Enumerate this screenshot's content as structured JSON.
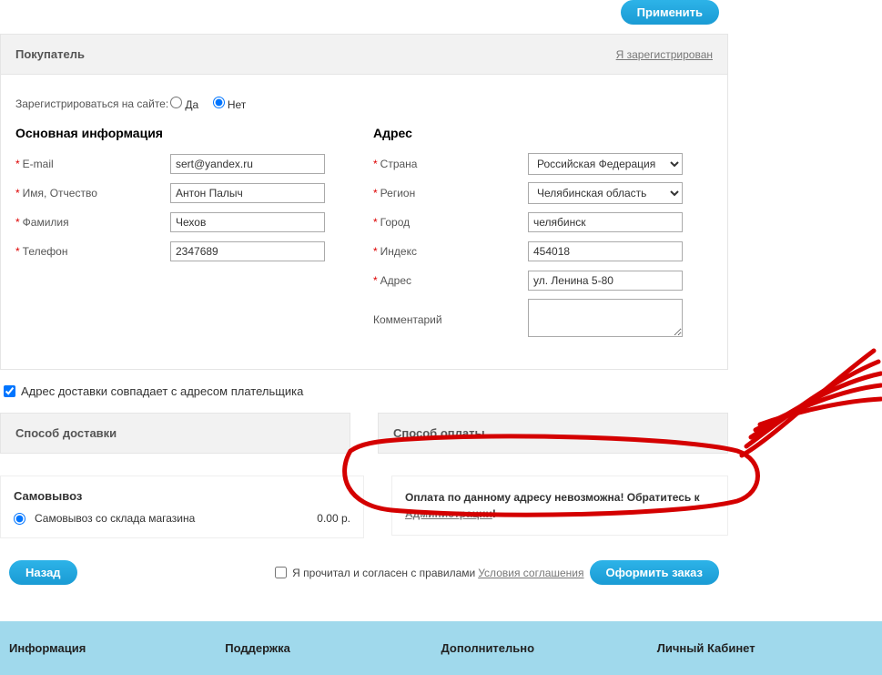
{
  "top": {
    "apply_label": "Применить"
  },
  "buyer_section": {
    "title": "Покупатель",
    "registered_link": "Я зарегистрирован"
  },
  "register": {
    "label": "Зарегистрироваться на сайте:",
    "yes": "Да",
    "no": "Нет"
  },
  "main_info_title": "Основная информация",
  "main_info": {
    "email_label": "E-mail",
    "email_value": "sert@yandex.ru",
    "name_label": "Имя, Отчество",
    "name_value": "Антон Палыч",
    "surname_label": "Фамилия",
    "surname_value": "Чехов",
    "phone_label": "Телефон",
    "phone_value": "2347689"
  },
  "address_title": "Адрес",
  "address": {
    "country_label": "Страна",
    "country_value": "Российская Федерация",
    "region_label": "Регион",
    "region_value": "Челябинская область",
    "city_label": "Город",
    "city_value": "челябинск",
    "index_label": "Индекс",
    "index_value": "454018",
    "addr_label": "Адрес",
    "addr_value": "ул. Ленина 5-80",
    "comment_label": "Комментарий",
    "comment_value": ""
  },
  "same_address_label": "Адрес доставки совпадает с адресом плательщика",
  "delivery_header": "Способ доставки",
  "payment_header": "Способ оплаты",
  "delivery": {
    "title": "Самовывоз",
    "option_label": "Самовывоз со склада магазина",
    "price": "0.00 р."
  },
  "payment_error": {
    "text": "Оплата по данному адресу невозможна! Обратитесь к ",
    "link": "Администрации",
    "tail": "!"
  },
  "bottom": {
    "back_label": "Назад",
    "agree_text": "Я прочитал и согласен с правилами",
    "terms_link": "Условия соглашения",
    "submit_label": "Оформить заказ"
  },
  "footer": {
    "col1": "Информация",
    "col2": "Поддержка",
    "col3": "Дополнительно",
    "col4": "Личный Кабинет"
  }
}
